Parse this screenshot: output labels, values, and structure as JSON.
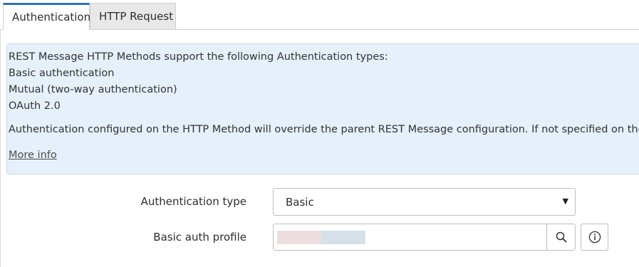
{
  "tabs": [
    {
      "label": "Authentication",
      "active": true
    },
    {
      "label": "HTTP Request",
      "active": false
    }
  ],
  "info": {
    "lines": [
      "REST Message HTTP Methods support the following Authentication types:",
      "Basic authentication",
      "Mutual (two-way authentication)",
      "OAuth 2.0",
      "Authentication configured on the HTTP Method will override the parent REST Message configuration. If not specified on the HTTP Method, the authentication configured on the parent REST Message will be used."
    ],
    "more_info": "More info"
  },
  "form": {
    "auth_type": {
      "label": "Authentication type",
      "value": "Basic"
    },
    "basic_auth_profile": {
      "label": "Basic auth profile",
      "value": ""
    }
  },
  "icons": {
    "dropdown": "caret-down-icon",
    "lookup": "search-icon",
    "details": "info-icon"
  },
  "colors": {
    "active_tab_accent": "#2d73b9",
    "info_background": "#e6f0fa",
    "inactive_tab_background": "#e8e8e8"
  }
}
